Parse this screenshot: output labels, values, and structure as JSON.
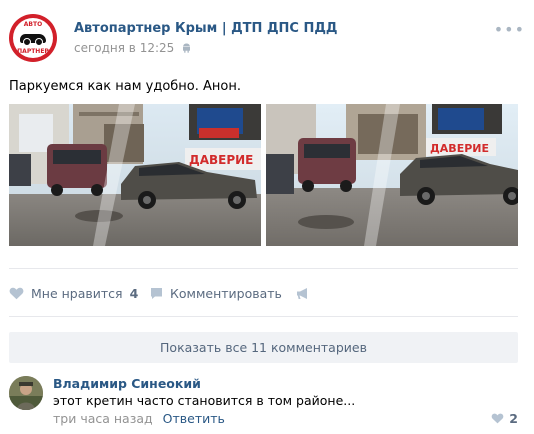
{
  "post": {
    "group_name": "Автопартнер Крым | ДТП ДПС ПДД",
    "timestamp": "сегодня в 12:25",
    "avatar_top_text": "АВТО",
    "avatar_bottom_text": "ПАРТНЕР",
    "text": "Паркуемся как нам удобно. Анон.",
    "photos": [
      "photo-parked-car-left",
      "photo-parked-car-right"
    ],
    "photo_sign_text": "ДАВЕРИЕ"
  },
  "actions": {
    "like_label": "Мне нравится",
    "like_count": "4",
    "comment_label": "Комментировать",
    "share_icon": "megaphone-icon"
  },
  "comments": {
    "show_all_label": "Показать все 11 комментариев",
    "items": [
      {
        "author": "Владимир Синеокий",
        "text": "этот кретин часто становится в том районе...",
        "time": "три часа назад",
        "reply_label": "Ответить",
        "likes": "2"
      }
    ]
  },
  "colors": {
    "link": "#2a5885",
    "muted": "#939393",
    "action": "#5b6b80",
    "brand_red": "#d2202a",
    "divider": "#e7e8ec",
    "button_bg": "#f0f2f5"
  }
}
